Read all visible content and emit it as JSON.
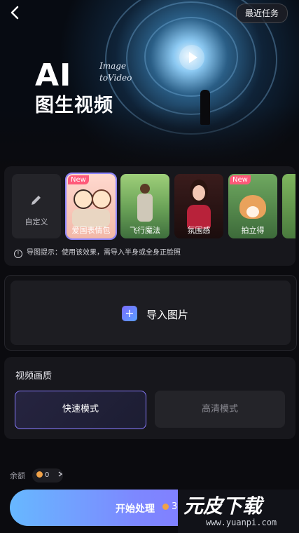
{
  "header": {
    "recent_tasks": "最近任务",
    "banner_ai": "AI",
    "banner_subtitle_line1": "Image",
    "banner_subtitle_line2": "toVideo",
    "banner_title": "图生视频"
  },
  "styles": {
    "items": [
      {
        "label": "自定义",
        "icon": "pencil-icon"
      },
      {
        "label": "爱国表情包",
        "badge": "New"
      },
      {
        "label": "飞行魔法"
      },
      {
        "label": "氛围感"
      },
      {
        "label": "拍立得",
        "badge": "New"
      }
    ],
    "tip": "导图提示：使用该效果，需导入半身或全身正脸照"
  },
  "upload": {
    "label": "导入图片"
  },
  "quality": {
    "title": "视频画质",
    "options": [
      {
        "label": "快速模式",
        "selected": true
      },
      {
        "label": "高清模式",
        "selected": false
      }
    ]
  },
  "balance": {
    "label": "余额",
    "value": "0"
  },
  "action": {
    "label": "开始处理",
    "cost": "35"
  },
  "watermark": {
    "text": "元皮下载",
    "url": "www.yuanpi.com"
  },
  "colors": {
    "accent": "#8a7cff",
    "button_start": "#67b8ff",
    "button_end": "#8a6cff",
    "new_badge": "#ff5a7a"
  }
}
